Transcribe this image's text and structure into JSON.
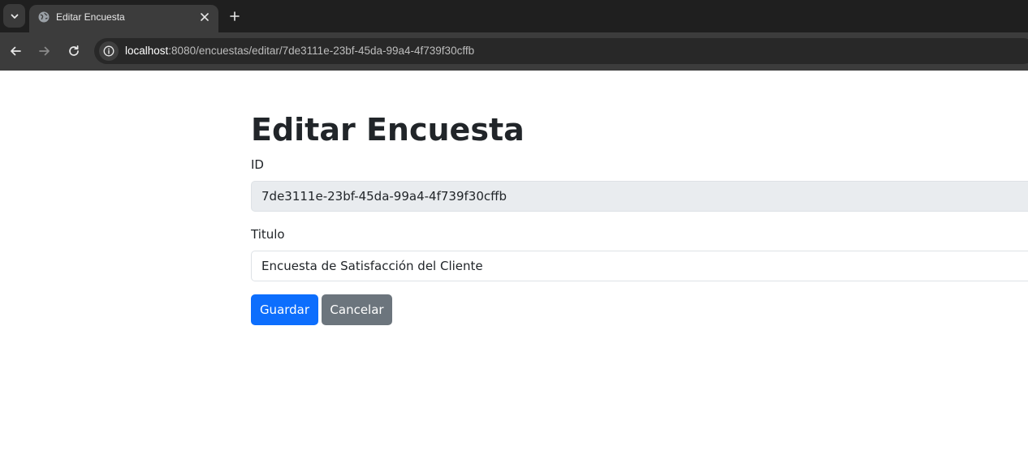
{
  "browser": {
    "tab": {
      "title": "Editar Encuesta"
    },
    "address_bar": {
      "host": "localhost",
      "path": ":8080/encuestas/editar/7de3111e-23bf-45da-99a4-4f739f30cffb"
    },
    "icons": {
      "tab_search": "chevron-down-icon",
      "favicon": "globe-icon",
      "tab_close": "close-icon",
      "new_tab": "plus-icon",
      "back": "arrow-left-icon",
      "forward": "arrow-right-icon",
      "reload": "reload-icon",
      "site_info": "info-icon"
    }
  },
  "page": {
    "title": "Editar Encuesta",
    "form": {
      "id_label": "ID",
      "id_value": "7de3111e-23bf-45da-99a4-4f739f30cffb",
      "titulo_label": "Titulo",
      "titulo_value": "Encuesta de Satisfacción del Cliente",
      "save_label": "Guardar",
      "cancel_label": "Cancelar"
    }
  },
  "colors": {
    "primary": "#0d6efd",
    "secondary": "#6c757d",
    "readonly_bg": "#e9ecef",
    "text": "#212529"
  }
}
